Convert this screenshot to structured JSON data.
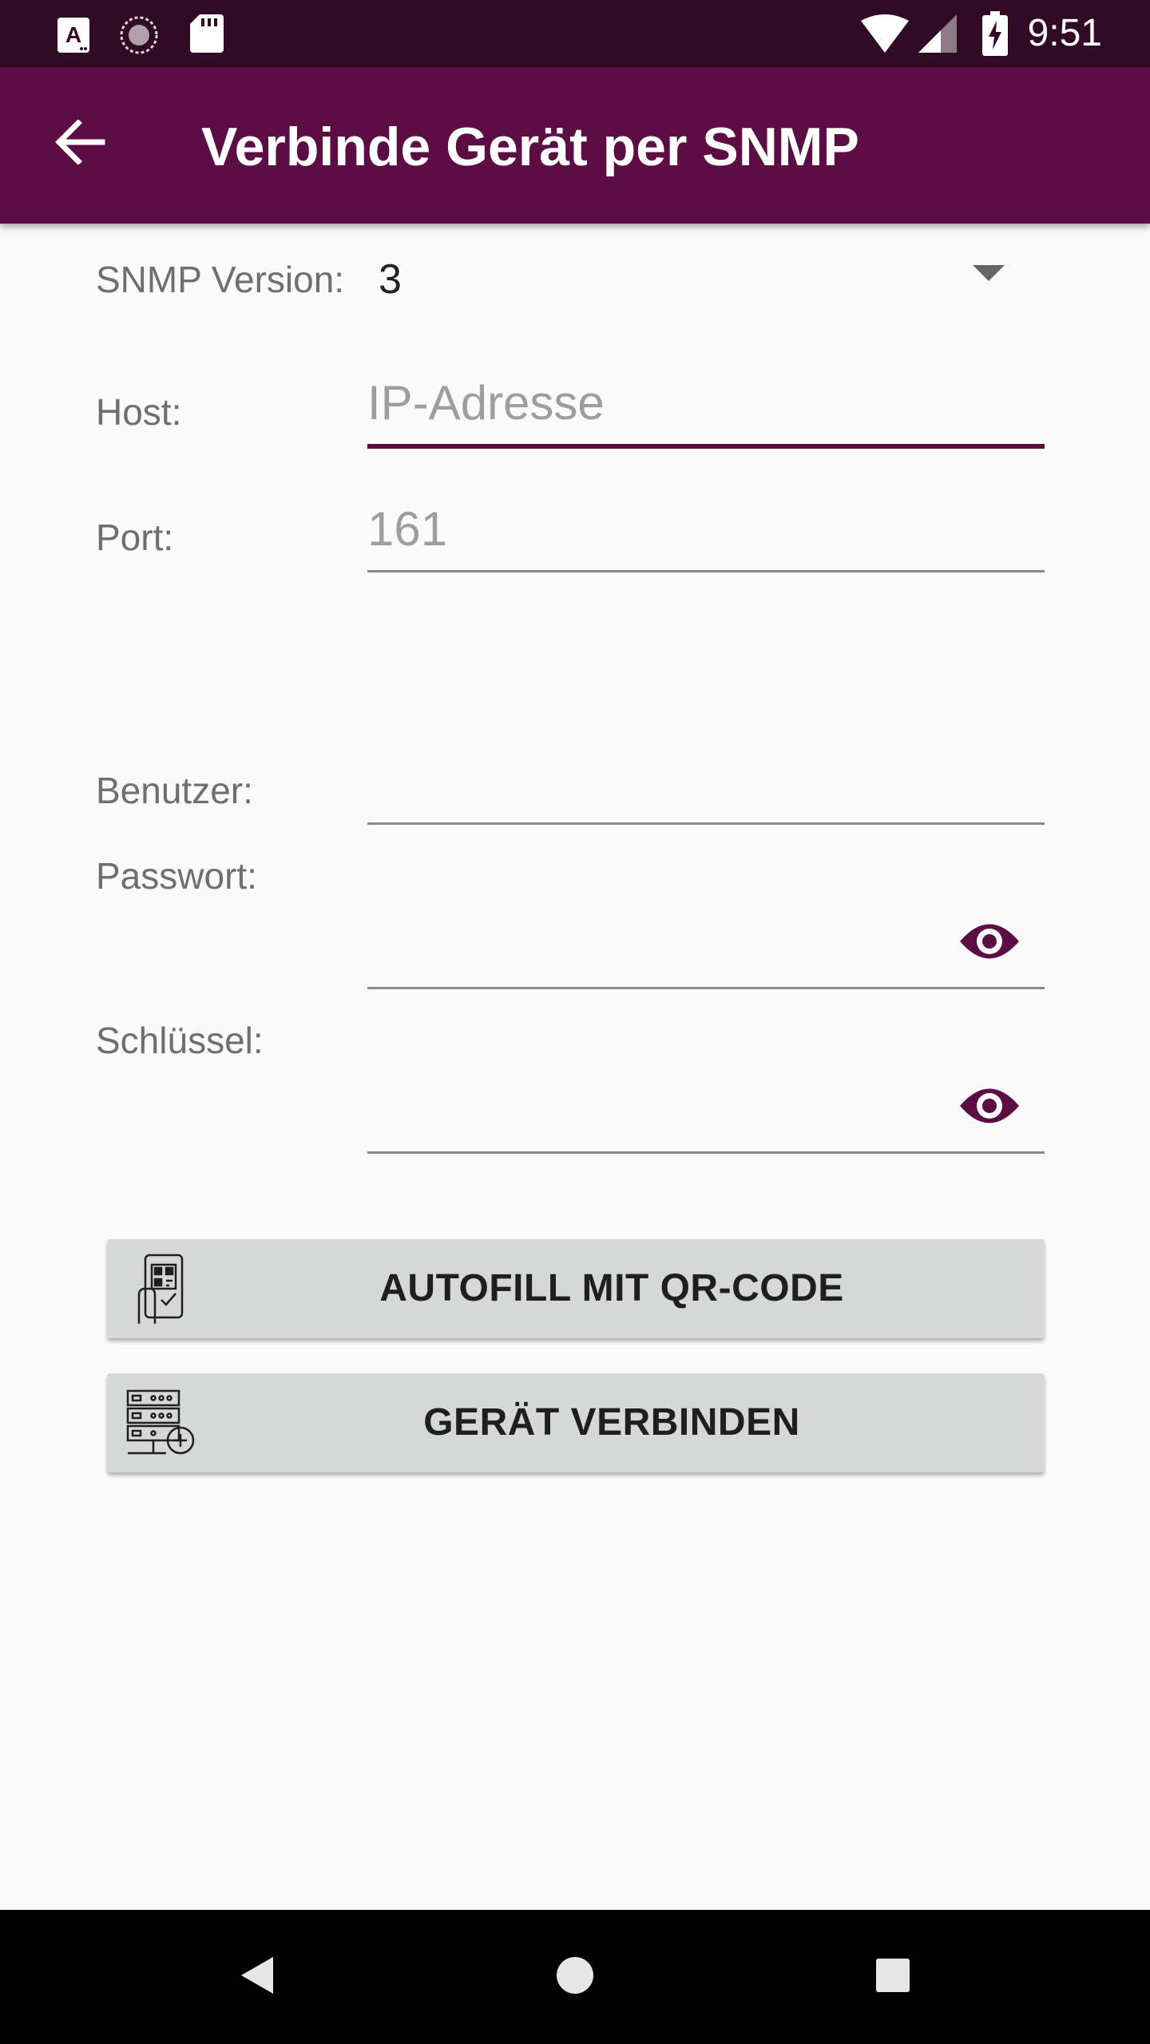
{
  "status_bar": {
    "time": "9:51",
    "icons": [
      "a-notification-icon",
      "sync-icon",
      "sd-card-icon",
      "wifi-icon",
      "cell-signal-icon",
      "battery-charging-icon"
    ]
  },
  "app_bar": {
    "title": "Verbinde Gerät per SNMP",
    "back_icon": "arrow-left-icon"
  },
  "form": {
    "snmp_version": {
      "label": "SNMP Version:",
      "value": "3"
    },
    "host": {
      "label": "Host:",
      "placeholder": "IP-Adresse",
      "value": ""
    },
    "port": {
      "label": "Port:",
      "placeholder": "161",
      "value": ""
    },
    "user": {
      "label": "Benutzer:",
      "value": ""
    },
    "password": {
      "label": "Passwort:",
      "value": "",
      "toggle_icon": "eye-icon"
    },
    "key": {
      "label": "Schlüssel:",
      "value": "",
      "toggle_icon": "eye-icon"
    }
  },
  "buttons": {
    "autofill": {
      "label": "AUTOFILL MIT QR-CODE",
      "icon": "qr-phone-icon"
    },
    "connect": {
      "label": "GERÄT VERBINDEN",
      "icon": "server-add-icon"
    }
  },
  "nav_bar": {
    "icons": [
      "back-triangle-icon",
      "home-circle-icon",
      "recents-square-icon"
    ]
  },
  "colors": {
    "primary": "#5c0e44",
    "status_bar": "#310a24",
    "button_bg": "#d6d7d7",
    "background": "#fafafa"
  }
}
